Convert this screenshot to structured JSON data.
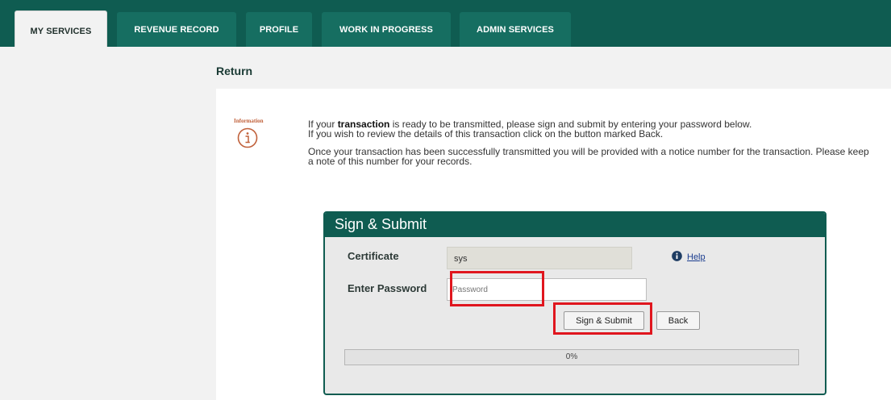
{
  "nav": {
    "tabs": [
      {
        "label": "MY SERVICES",
        "active": true
      },
      {
        "label": "REVENUE RECORD",
        "active": false
      },
      {
        "label": "PROFILE",
        "active": false
      },
      {
        "label": "WORK IN PROGRESS",
        "active": false
      },
      {
        "label": "ADMIN SERVICES",
        "active": false
      }
    ]
  },
  "page": {
    "title": "Return"
  },
  "info": {
    "label": "Information",
    "line1_pre": "If your ",
    "line1_bold": "transaction",
    "line1_post": " is ready to be transmitted, please sign and submit by entering your password below.",
    "line2": "If you wish to review the details of this transaction click on the button marked Back.",
    "para2": "Once your transaction has been successfully transmitted you will be provided with a notice number for the transaction. Please keep a note of this number for your records."
  },
  "sign_submit": {
    "title": "Sign & Submit",
    "certificate_label": "Certificate",
    "certificate_value": "sys",
    "help_label": "Help",
    "password_label": "Enter Password",
    "password_placeholder": "Password",
    "submit_label": "Sign & Submit",
    "back_label": "Back",
    "progress_text": "0%",
    "progress_value": 0
  },
  "colors": {
    "brand": "#0f5c51",
    "highlight": "#e0161e",
    "info_accent": "#c0603a"
  }
}
